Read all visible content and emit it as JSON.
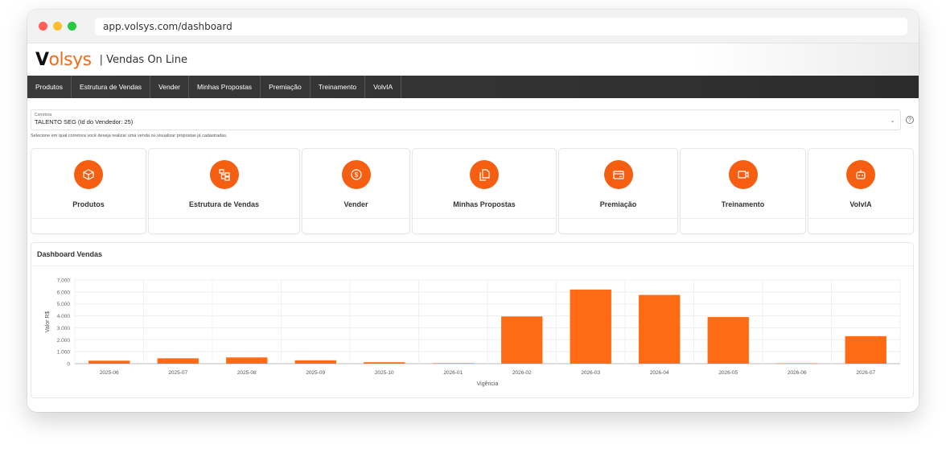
{
  "browser": {
    "url": "app.volsys.com/dashboard"
  },
  "header": {
    "logo_prefix": "V",
    "logo_o": "o",
    "logo_rest": "lsys",
    "app_title": "| Vendas On Line"
  },
  "nav": {
    "items": [
      "Produtos",
      "Estrutura de Vendas",
      "Vender",
      "Minhas Propostas",
      "Premiação",
      "Treinamento",
      "VolvIA"
    ]
  },
  "corretora": {
    "label": "Corretora",
    "value": "TALENTO SEG (Id do Vendedor: 25)",
    "helper": "Selecione em qual corretora você deseja realizar uma venda ou visualizar propostas já cadastradas."
  },
  "cards": [
    {
      "label": "Produtos",
      "icon": "box-icon"
    },
    {
      "label": "Estrutura de Vendas",
      "icon": "hierarchy-icon"
    },
    {
      "label": "Vender",
      "icon": "dollar-coin-icon"
    },
    {
      "label": "Minhas Propostas",
      "icon": "documents-icon"
    },
    {
      "label": "Premiação",
      "icon": "credit-card-icon"
    },
    {
      "label": "Treinamento",
      "icon": "video-camera-icon"
    },
    {
      "label": "VolvIA",
      "icon": "robot-icon"
    }
  ],
  "dashboard": {
    "title": "Dashboard Vendas"
  },
  "colors": {
    "accent": "#f65f12",
    "nav_bg": "#333333"
  },
  "chart_data": {
    "type": "bar",
    "categories": [
      "2025-06",
      "2025-07",
      "2025-08",
      "2025-09",
      "2025-10",
      "2026-01",
      "2026-02",
      "2026-03",
      "2026-04",
      "2026-05",
      "2026-06",
      "2026-07"
    ],
    "values": [
      250,
      450,
      520,
      280,
      120,
      40,
      3950,
      6200,
      5750,
      3900,
      30,
      2300
    ],
    "xlabel": "Vigência",
    "ylabel": "Valor R$",
    "ylim": [
      0,
      7000
    ],
    "yticks": [
      "0",
      "1.000",
      "2.000",
      "3.000",
      "4.000",
      "5.000",
      "6.000",
      "7.000"
    ],
    "grid": true,
    "color": "#ff6a13"
  }
}
